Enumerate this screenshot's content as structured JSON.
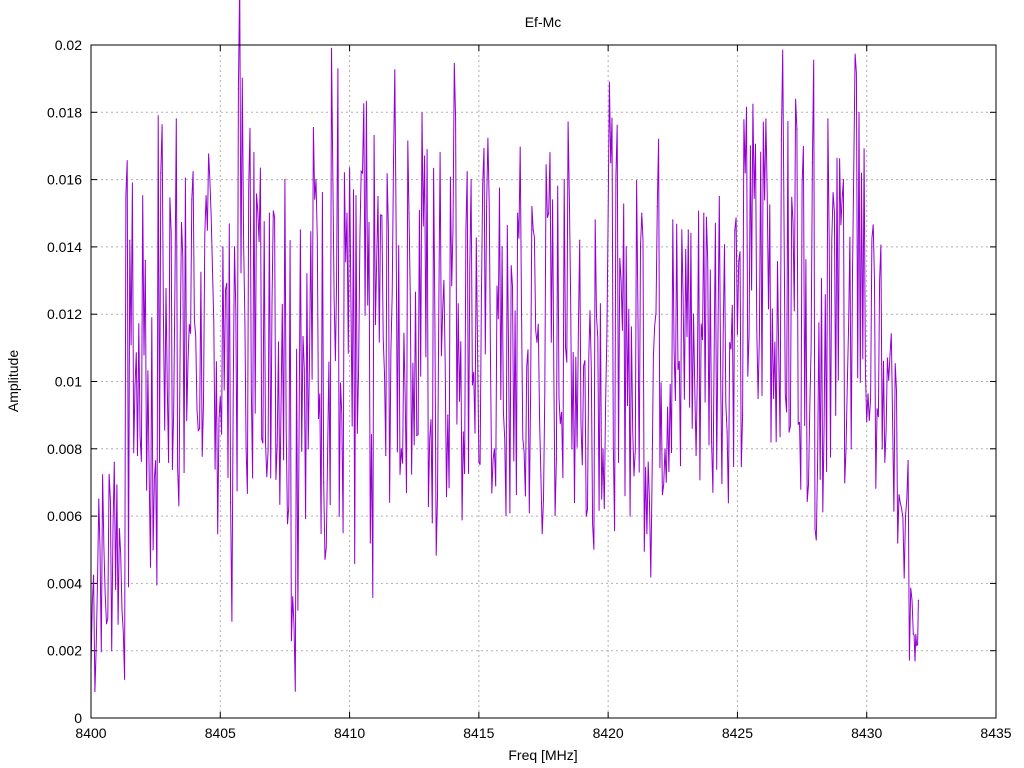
{
  "chart_data": {
    "type": "line",
    "title": "Ef-Mc",
    "xlabel": "Freq [MHz]",
    "ylabel": "Amplitude",
    "xlim": [
      8400,
      8435
    ],
    "ylim": [
      0,
      0.02
    ],
    "x_ticks": [
      "8400",
      "8405",
      "8410",
      "8415",
      "8420",
      "8425",
      "8430",
      "8435"
    ],
    "y_ticks": [
      "0",
      "0.002",
      "0.004",
      "0.006",
      "0.008",
      "0.01",
      "0.012",
      "0.014",
      "0.016",
      "0.018",
      "0.02"
    ],
    "grid": true,
    "legend": "none",
    "series": [
      {
        "color": "#9400d3",
        "x": [
          8400.0,
          8400.3,
          8400.6,
          8400.9,
          8401.2,
          8401.5,
          8401.8,
          8402.1,
          8402.4,
          8402.7,
          8403.0,
          8403.3,
          8403.6,
          8403.9,
          8404.2,
          8404.5,
          8404.8,
          8405.1,
          8405.4,
          8405.7,
          8406.0,
          8406.3,
          8406.6,
          8406.9,
          8407.2,
          8407.5,
          8407.8,
          8408.1,
          8408.4,
          8408.7,
          8409.0,
          8409.3,
          8409.6,
          8409.9,
          8410.2,
          8410.5,
          8410.8,
          8411.1,
          8411.4,
          8411.7,
          8412.0,
          8412.3,
          8412.6,
          8412.9,
          8413.2,
          8413.5,
          8413.8,
          8414.1,
          8414.4,
          8414.7,
          8415.0,
          8415.3,
          8415.6,
          8415.9,
          8416.2,
          8416.5,
          8416.8,
          8417.1,
          8417.4,
          8417.7,
          8418.0,
          8418.3,
          8418.6,
          8418.9,
          8419.2,
          8419.5,
          8419.8,
          8420.1,
          8420.4,
          8420.7,
          8421.0,
          8421.3,
          8421.6,
          8421.9,
          8422.2,
          8422.5,
          8422.8,
          8423.1,
          8423.4,
          8423.7,
          8424.0,
          8424.3,
          8424.6,
          8424.9,
          8425.2,
          8425.5,
          8425.8,
          8426.1,
          8426.4,
          8426.7,
          8427.0,
          8427.3,
          8427.6,
          8427.9,
          8428.2,
          8428.5,
          8428.8,
          8429.1,
          8429.4,
          8429.7,
          8430.0,
          8430.3,
          8430.6,
          8430.9,
          8431.2,
          8431.5,
          8431.8,
          8432.0
        ],
        "y": [
          0.0015,
          0.0065,
          0.0028,
          0.0076,
          0.0032,
          0.0142,
          0.0078,
          0.0136,
          0.005,
          0.0162,
          0.0076,
          0.0178,
          0.0073,
          0.0154,
          0.0086,
          0.0145,
          0.0074,
          0.014,
          0.0064,
          0.0187,
          0.008,
          0.0168,
          0.0083,
          0.015,
          0.0081,
          0.016,
          0.0036,
          0.0145,
          0.008,
          0.016,
          0.007,
          0.0199,
          0.006,
          0.015,
          0.0046,
          0.0162,
          0.0052,
          0.0155,
          0.0078,
          0.0165,
          0.008,
          0.015,
          0.0084,
          0.0167,
          0.0058,
          0.0168,
          0.009,
          0.0178,
          0.0085,
          0.016,
          0.0076,
          0.0152,
          0.008,
          0.014,
          0.0061,
          0.015,
          0.0066,
          0.0145,
          0.0072,
          0.015,
          0.0077,
          0.016,
          0.008,
          0.0142,
          0.0062,
          0.0148,
          0.008,
          0.0165,
          0.0076,
          0.014,
          0.0072,
          0.015,
          0.0064,
          0.0152,
          0.008,
          0.0148,
          0.0075,
          0.0145,
          0.0078,
          0.015,
          0.0082,
          0.0155,
          0.0085,
          0.0145,
          0.009,
          0.017,
          0.0095,
          0.0178,
          0.0095,
          0.0172,
          0.0085,
          0.0175,
          0.0087,
          0.0165,
          0.0071,
          0.0178,
          0.009,
          0.016,
          0.008,
          0.018,
          0.0088,
          0.013,
          0.008,
          0.0108,
          0.0052,
          0.006,
          0.0025,
          0.0035
        ]
      }
    ]
  }
}
